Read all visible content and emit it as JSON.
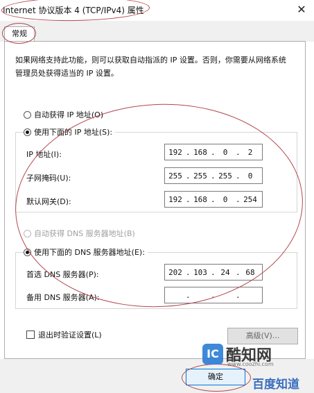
{
  "window": {
    "title": "Internet 协议版本 4 (TCP/IPv4) 属性",
    "close_icon": "✕"
  },
  "tabs": [
    {
      "label": "常规",
      "selected": true
    }
  ],
  "description": "如果网络支持此功能，则可以获取自动指派的 IP 设置。否则，你需要从网络系统管理员处获得适当的 IP 设置。",
  "ip_section": {
    "auto_label": "自动获得 IP 地址(O)",
    "auto_selected": false,
    "manual_label": "使用下面的 IP 地址(S):",
    "manual_selected": true,
    "fields": [
      {
        "label": "IP 地址(I):",
        "octets": [
          "192",
          "168",
          "0",
          "2"
        ]
      },
      {
        "label": "子网掩码(U):",
        "octets": [
          "255",
          "255",
          "255",
          "0"
        ]
      },
      {
        "label": "默认网关(D):",
        "octets": [
          "192",
          "168",
          "0",
          "254"
        ]
      }
    ]
  },
  "dns_section": {
    "auto_label": "自动获得 DNS 服务器地址(B)",
    "auto_selected": false,
    "auto_disabled": true,
    "manual_label": "使用下面的 DNS 服务器地址(E):",
    "manual_selected": true,
    "fields": [
      {
        "label": "首选 DNS 服务器(P):",
        "octets": [
          "202",
          "103",
          "24",
          "68"
        ]
      },
      {
        "label": "备用 DNS 服务器(A):",
        "octets": [
          "",
          "",
          "",
          ""
        ]
      }
    ]
  },
  "validate_checkbox": {
    "label": "退出时验证设置(L)",
    "checked": false
  },
  "advanced_button": {
    "label": "高级(V)..."
  },
  "ok_button": {
    "label": "确定"
  },
  "watermarks": {
    "logo_glyph": "IC",
    "site_name": "酷知网",
    "site_url": "www.coozhi.com",
    "second": "百度知道"
  },
  "colors": {
    "annotation": "#b2474e",
    "accent": "#0078d7",
    "dialog_bg": "#f0f0f0"
  }
}
